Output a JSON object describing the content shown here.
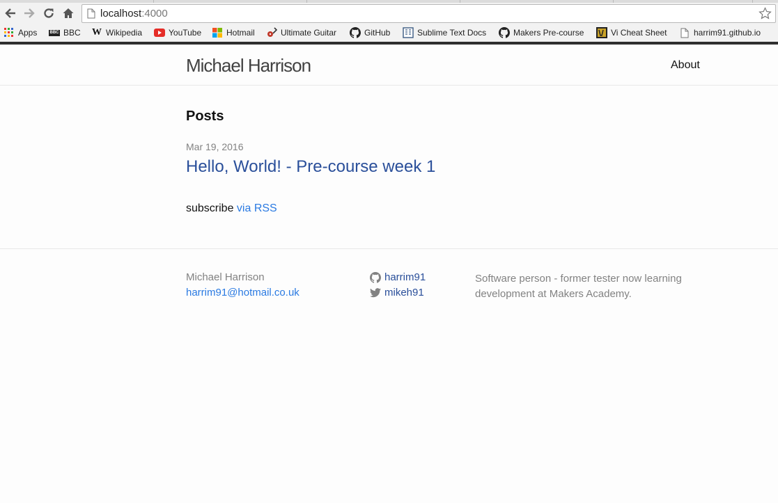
{
  "browser": {
    "url_host": "localhost",
    "url_port": ":4000",
    "bookmarks": [
      {
        "label": "Apps",
        "icon": "apps-grid-icon"
      },
      {
        "label": "BBC",
        "icon": "bbc-icon"
      },
      {
        "label": "Wikipedia",
        "icon": "wikipedia-icon"
      },
      {
        "label": "YouTube",
        "icon": "youtube-icon"
      },
      {
        "label": "Hotmail",
        "icon": "microsoft-icon"
      },
      {
        "label": "Ultimate Guitar",
        "icon": "guitar-icon"
      },
      {
        "label": "GitHub",
        "icon": "github-icon"
      },
      {
        "label": "Sublime Text Docs",
        "icon": "docs-icon"
      },
      {
        "label": "Makers Pre-course",
        "icon": "github-icon"
      },
      {
        "label": "Vi Cheat Sheet",
        "icon": "vi-icon"
      },
      {
        "label": "harrim91.github.io",
        "icon": "page-icon"
      }
    ],
    "bbc_logo_text": "BBC",
    "wikipedia_logo_text": "W"
  },
  "site": {
    "title": "Michael Harrison",
    "nav_about": "About"
  },
  "posts": {
    "heading": "Posts",
    "items": [
      {
        "date": "Mar 19, 2016",
        "title": "Hello, World! - Pre-course week 1"
      }
    ],
    "subscribe_text": "subscribe ",
    "rss_link": "via RSS"
  },
  "footer": {
    "name": "Michael Harrison",
    "email": "harrim91@hotmail.co.uk",
    "github_user": "harrim91",
    "twitter_user": "mikeh91",
    "description": "Software person - former tester now learning development at Makers Academy."
  },
  "colors": {
    "link": "#2a7ae2",
    "post_link": "#2a4f9a",
    "muted": "#828282"
  }
}
